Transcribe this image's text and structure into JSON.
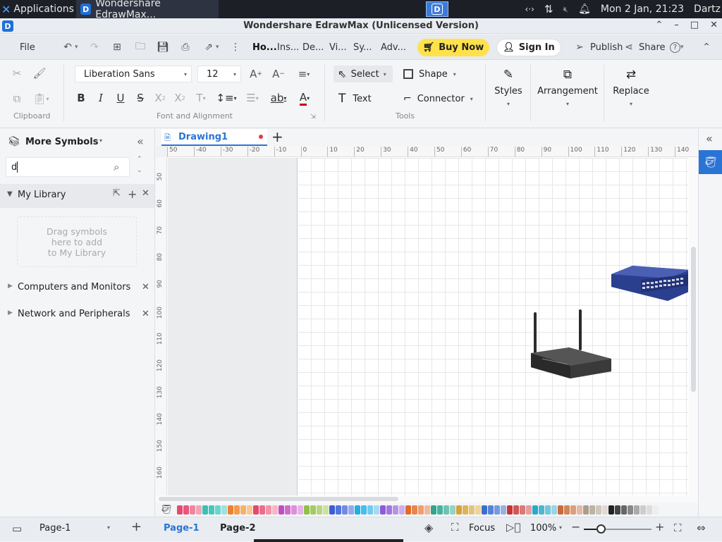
{
  "taskbar": {
    "applications": "Applications",
    "task_title": "Wondershare EdrawMax...",
    "clock": "Mon  2 Jan, 21:23",
    "user": "Dartz"
  },
  "window": {
    "title": "Wondershare EdrawMax (Unlicensed Version)"
  },
  "menu": {
    "file": "File",
    "tabs": [
      "Ho...",
      "Ins...",
      "De...",
      "Vi...",
      "Sy...",
      "Adv..."
    ],
    "buy_now": "Buy Now",
    "sign_in": "Sign In",
    "publish": "Publish",
    "share": "Share"
  },
  "ribbon": {
    "font_family": "Liberation Sans",
    "font_size": "12",
    "select": "Select",
    "shape": "Shape",
    "text": "Text",
    "connector": "Connector",
    "styles": "Styles",
    "arrangement": "Arrangement",
    "replace": "Replace",
    "groups": {
      "clipboard": "Clipboard",
      "font": "Font and Alignment",
      "tools": "Tools"
    }
  },
  "leftpanel": {
    "title": "More Symbols",
    "search_value": "d",
    "library": "My Library",
    "drag_hint": [
      "Drag symbols",
      "here to add",
      "to My Library"
    ],
    "categories": [
      "Computers and Monitors",
      "Network and Peripherals"
    ]
  },
  "document": {
    "tab": "Drawing1"
  },
  "ruler": {
    "h": [
      "50",
      "-40",
      "-30",
      "-20",
      "-10",
      "0",
      "10",
      "20",
      "30",
      "40",
      "50",
      "60",
      "70",
      "80",
      "90",
      "100",
      "110",
      "120",
      "130",
      "140"
    ],
    "v": [
      "50",
      "60",
      "70",
      "80",
      "90",
      "100",
      "110",
      "120",
      "130",
      "140",
      "150",
      "160"
    ]
  },
  "status": {
    "page_select": "Page-1",
    "pages": [
      "Page-1",
      "Page-2"
    ],
    "focus": "Focus",
    "zoom": "100%"
  },
  "palette": [
    "#e54b6a",
    "#e8567e",
    "#ef86a0",
    "#f0a6b7",
    "#3fbfb3",
    "#45c8c0",
    "#6ed3cc",
    "#9fe1dd",
    "#f08030",
    "#f39a4f",
    "#f5b06e",
    "#f8c98f",
    "#e04a6b",
    "#ec6d8a",
    "#f193aa",
    "#f5b7c6",
    "#c34dbf",
    "#cf6ccc",
    "#dc90d9",
    "#e6b3e4",
    "#8fc04a",
    "#a3cb62",
    "#b8d67f",
    "#cde29f",
    "#3b5ed6",
    "#5474de",
    "#6f8be3",
    "#94a9ea",
    "#1fb0e3",
    "#47bde8",
    "#74cced",
    "#a2dbf2",
    "#8e5bd8",
    "#a177de",
    "#b594e5",
    "#caafec",
    "#e06c2a",
    "#e7874f",
    "#ed9f71",
    "#f2b996",
    "#2fa58d",
    "#47b39d",
    "#6dc3b1",
    "#96d3c6",
    "#d5a33c",
    "#ddb35c",
    "#e4c47d",
    "#ebd49e",
    "#3c6fcd",
    "#5883d5",
    "#7599dd",
    "#97b1e6",
    "#c93434",
    "#d35555",
    "#dc7878",
    "#e59d9d",
    "#29a9c9",
    "#4db7d2",
    "#73c6db",
    "#9ad5e5",
    "#c96a3b",
    "#d2845b",
    "#dc9e7d",
    "#e6b89f",
    "#a89e8e",
    "#bcb3a5",
    "#cfc8bd",
    "#e0dbd3",
    "#222222",
    "#444444",
    "#666666",
    "#888888",
    "#aaaaaa",
    "#cccccc",
    "#dddddd",
    "#eeeeee"
  ]
}
